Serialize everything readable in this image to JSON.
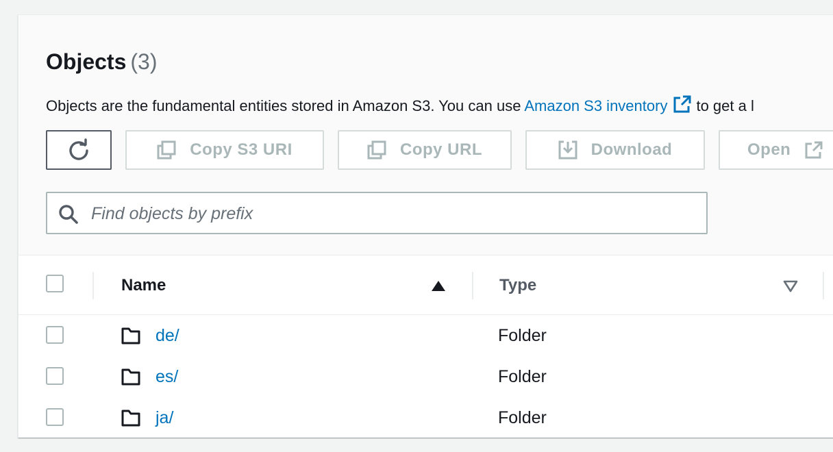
{
  "objects": {
    "title": "Objects",
    "count": "(3)",
    "description_prefix": "Objects are the fundamental entities stored in Amazon S3. You can use ",
    "description_link": "Amazon S3 inventory",
    "description_suffix": "to get a l"
  },
  "toolbar": {
    "refresh_icon": "refresh-icon",
    "copy_s3_uri_label": "Copy S3 URI",
    "copy_url_label": "Copy URL",
    "download_label": "Download",
    "open_label": "Open"
  },
  "search": {
    "placeholder": "Find objects by prefix",
    "value": ""
  },
  "table": {
    "columns": [
      {
        "label": "Name",
        "sort": "ascending"
      },
      {
        "label": "Type",
        "sort": "none"
      }
    ],
    "rows": [
      {
        "name": "de/",
        "type": "Folder"
      },
      {
        "name": "es/",
        "type": "Folder"
      },
      {
        "name": "ja/",
        "type": "Folder"
      }
    ]
  },
  "colors": {
    "link": "#0073bb",
    "disabled_text": "#aab7b8",
    "text": "#16191f"
  }
}
